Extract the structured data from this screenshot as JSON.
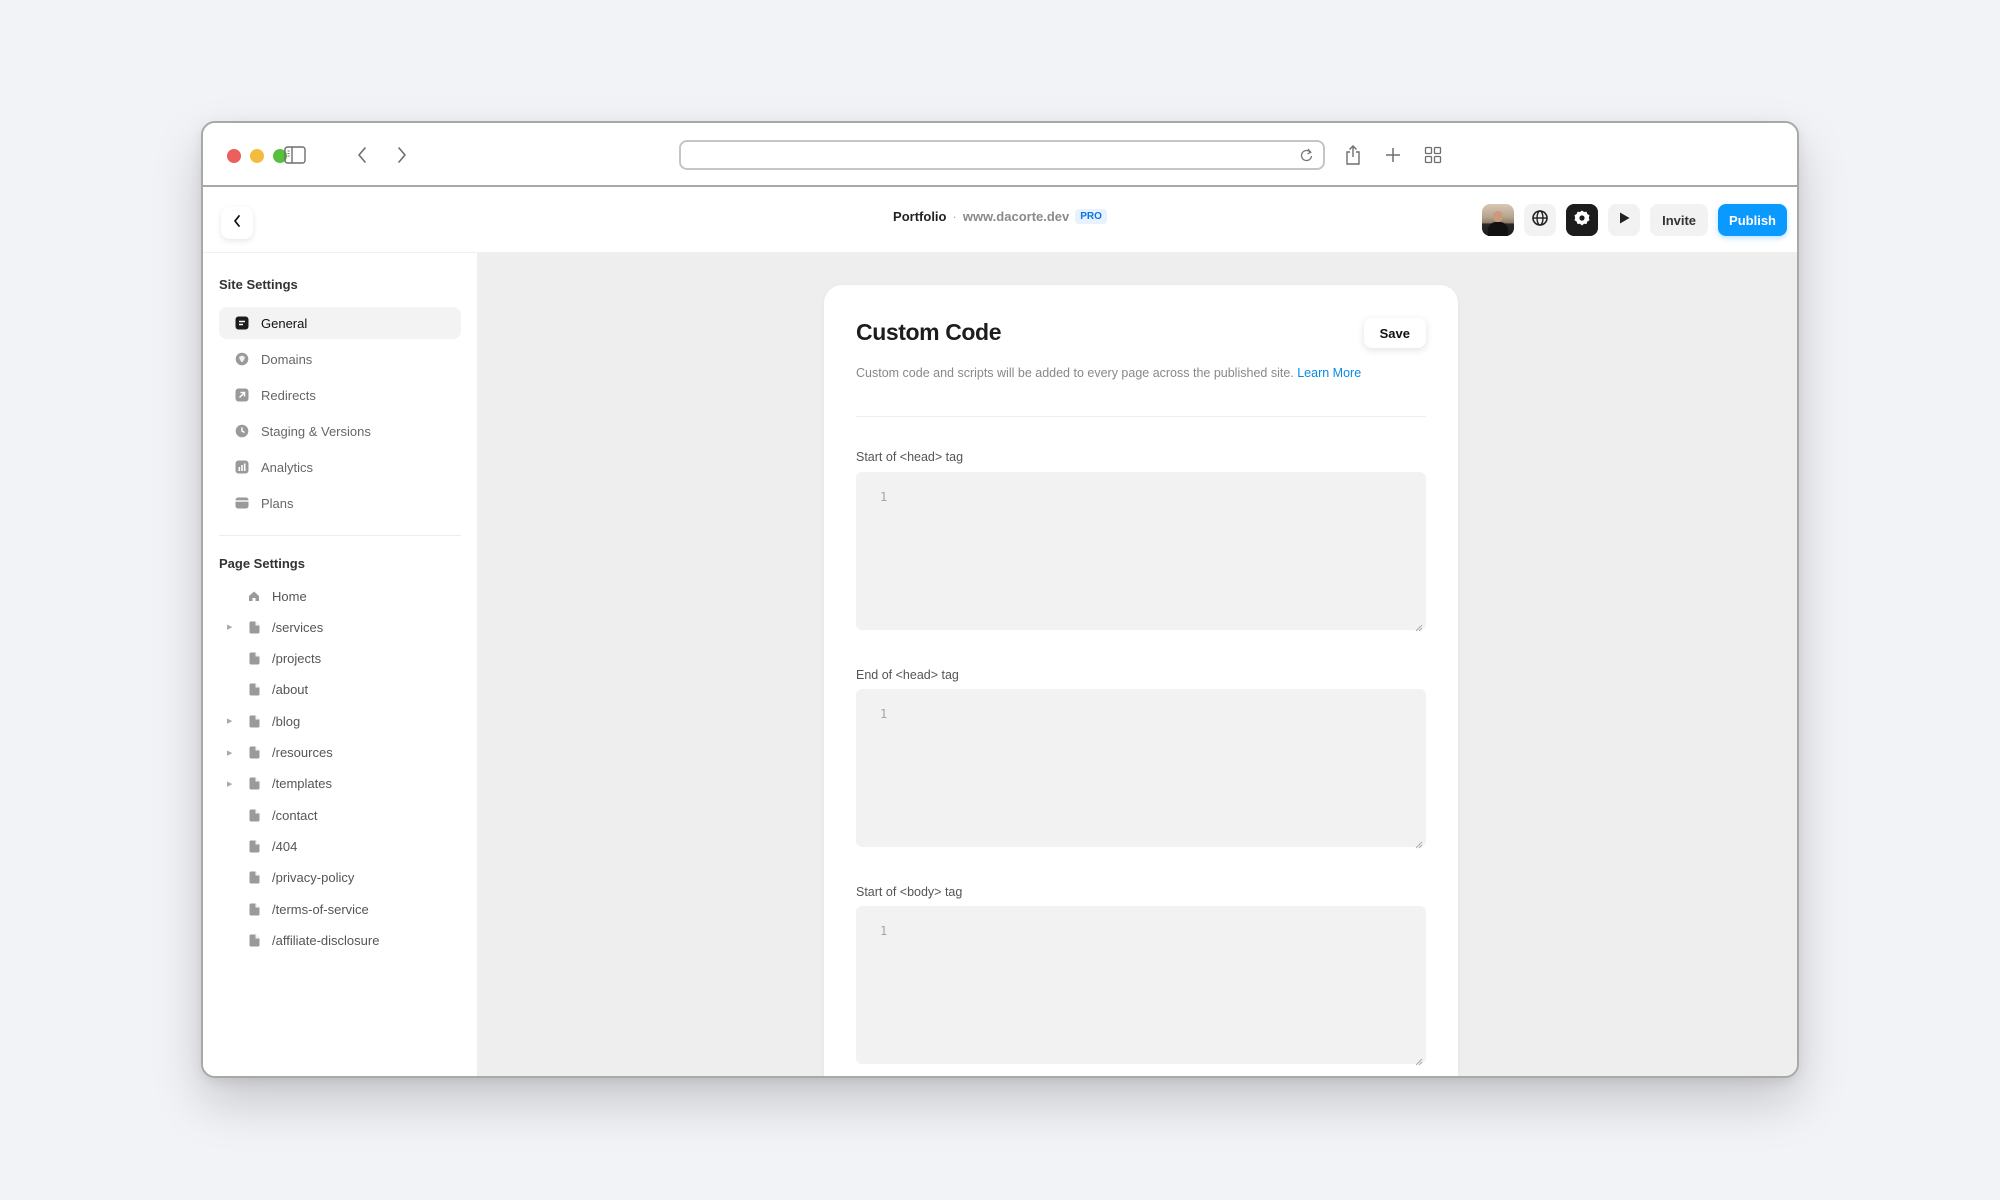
{
  "browser": {
    "address_value": "",
    "toolbar_icons": [
      "sidebar-toggle-icon",
      "back-arrow-icon",
      "forward-arrow-icon",
      "reload-icon",
      "share-icon",
      "new-tab-icon",
      "tab-overview-icon"
    ]
  },
  "header": {
    "site_name": "Portfolio",
    "separator": "·",
    "domain": "www.dacorte.dev",
    "badge": "PRO",
    "invite_label": "Invite",
    "publish_label": "Publish",
    "accent_color": "#0a99ff"
  },
  "sidebar": {
    "site_settings_title": "Site Settings",
    "site_items": [
      {
        "label": "General",
        "icon": "general-icon",
        "active": true
      },
      {
        "label": "Domains",
        "icon": "globe-icon",
        "active": false
      },
      {
        "label": "Redirects",
        "icon": "redirect-icon",
        "active": false
      },
      {
        "label": "Staging & Versions",
        "icon": "clock-icon",
        "active": false
      },
      {
        "label": "Analytics",
        "icon": "analytics-icon",
        "active": false
      },
      {
        "label": "Plans",
        "icon": "card-icon",
        "active": false
      }
    ],
    "page_settings_title": "Page Settings",
    "pages": [
      {
        "label": "Home",
        "icon": "home-icon",
        "expandable": false
      },
      {
        "label": "/services",
        "icon": "page-icon",
        "expandable": true
      },
      {
        "label": "/projects",
        "icon": "page-icon",
        "expandable": false
      },
      {
        "label": "/about",
        "icon": "page-icon",
        "expandable": false
      },
      {
        "label": "/blog",
        "icon": "page-icon",
        "expandable": true
      },
      {
        "label": "/resources",
        "icon": "page-icon",
        "expandable": true
      },
      {
        "label": "/templates",
        "icon": "page-icon",
        "expandable": true
      },
      {
        "label": "/contact",
        "icon": "page-icon",
        "expandable": false
      },
      {
        "label": "/404",
        "icon": "page-icon",
        "expandable": false
      },
      {
        "label": "/privacy-policy",
        "icon": "page-icon",
        "expandable": false
      },
      {
        "label": "/terms-of-service",
        "icon": "page-icon",
        "expandable": false
      },
      {
        "label": "/affiliate-disclosure",
        "icon": "page-icon",
        "expandable": false
      }
    ]
  },
  "main": {
    "title": "Custom Code",
    "save_label": "Save",
    "description": "Custom code and scripts will be added to every page across the published site.",
    "learn_more": "Learn More",
    "fields": [
      {
        "label": "Start of <head> tag",
        "line_number": "1",
        "value": ""
      },
      {
        "label": "End of <head> tag",
        "line_number": "1",
        "value": ""
      },
      {
        "label": "Start of <body> tag",
        "line_number": "1",
        "value": ""
      }
    ]
  }
}
